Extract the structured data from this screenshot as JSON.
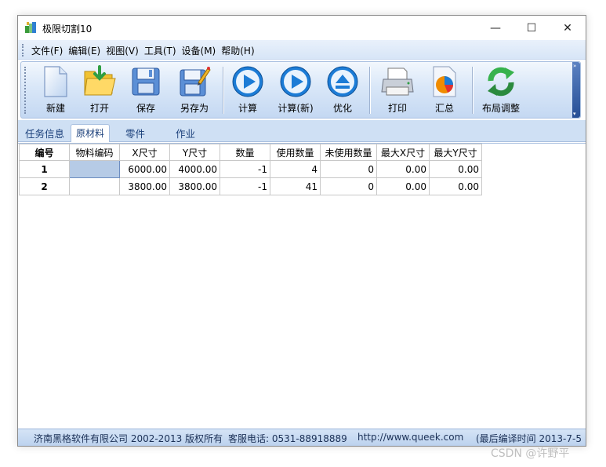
{
  "window": {
    "title": "极限切割10",
    "icon": "app-logo-icon",
    "controls": {
      "minimize": "—",
      "maximize": "☐",
      "close": "✕"
    }
  },
  "menubar": {
    "items": [
      {
        "label": "文件(F)"
      },
      {
        "label": "编辑(E)"
      },
      {
        "label": "视图(V)"
      },
      {
        "label": "工具(T)"
      },
      {
        "label": "设备(M)"
      },
      {
        "label": "帮助(H)"
      }
    ]
  },
  "toolbar": {
    "new": {
      "label": "新建",
      "icon": "new-document-icon"
    },
    "open": {
      "label": "打开",
      "icon": "open-folder-icon"
    },
    "save": {
      "label": "保存",
      "icon": "floppy-disk-icon"
    },
    "saveas": {
      "label": "另存为",
      "icon": "save-as-icon"
    },
    "calc": {
      "label": "计算",
      "icon": "play-icon"
    },
    "calcnew": {
      "label": "计算(新)",
      "icon": "play-icon"
    },
    "optimize": {
      "label": "优化",
      "icon": "eject-icon"
    },
    "print": {
      "label": "打印",
      "icon": "printer-icon"
    },
    "summary": {
      "label": "汇总",
      "icon": "pie-chart-icon"
    },
    "layout": {
      "label": "布局调整",
      "icon": "refresh-icon"
    },
    "overflow_top": "»",
    "overflow_bottom": "▾"
  },
  "tabs": [
    {
      "label": "任务信息",
      "active": false
    },
    {
      "label": "原材料",
      "active": true
    },
    {
      "label": "零件",
      "active": false
    },
    {
      "label": "作业",
      "active": false
    }
  ],
  "grid": {
    "headers": [
      "编号",
      "物料编码",
      "X尺寸",
      "Y尺寸",
      "数量",
      "使用数量",
      "未使用数量",
      "最大X尺寸",
      "最大Y尺寸"
    ],
    "rows": [
      [
        "1",
        "",
        "6000.00",
        "4000.00",
        "-1",
        "4",
        "0",
        "0.00",
        "0.00"
      ],
      [
        "2",
        "",
        "3800.00",
        "3800.00",
        "-1",
        "41",
        "0",
        "0.00",
        "0.00"
      ]
    ]
  },
  "statusbar": {
    "company": "济南黑格软件有限公司 2002-2013 版权所有",
    "phone": "客服电话: 0531-88918889",
    "url": "http://www.queek.com",
    "build": "(最后编译时间 2013-7-5"
  },
  "watermark": "CSDN @许野平",
  "colors": {
    "accent_blue": "#1a73d9",
    "toolbar_bg": "#d9e7f8",
    "selection": "#b6cbe6"
  }
}
